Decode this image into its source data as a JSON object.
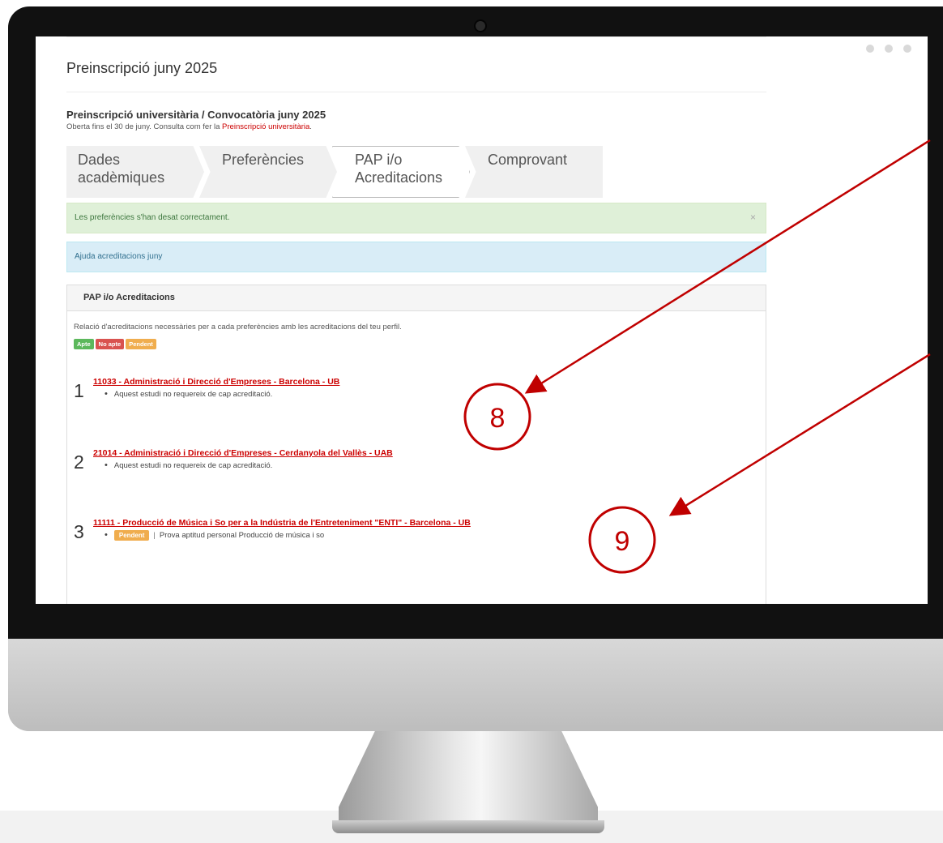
{
  "page": {
    "title": "Preinscripció juny 2025",
    "subtitle": "Preinscripció universitària / Convocatòria juny 2025",
    "subtext_prefix": "Oberta fins el 30 de juny. Consulta com fer la ",
    "subtext_link": "Preinscripció universitària",
    "subtext_suffix": "."
  },
  "steps": [
    {
      "label": "Dades acadèmiques"
    },
    {
      "label": "Preferències"
    },
    {
      "label": "PAP i/o Acreditacions"
    },
    {
      "label": "Comprovant"
    }
  ],
  "alerts": {
    "success": "Les preferències s'han desat correctament.",
    "close": "×",
    "info": "Ajuda acreditacions juny"
  },
  "panel": {
    "heading": "PAP i/o Acreditacions",
    "intro": "Relació d'acreditacions necessàries per a cada preferències amb les acreditacions del teu perfil.",
    "badges": {
      "apte": "Apte",
      "no_apte": "No apte",
      "pendent": "Pendent"
    }
  },
  "preferences": [
    {
      "num": "1",
      "title": "11033 - Administració i Direcció d'Empreses - Barcelona - UB",
      "note": "Aquest estudi no requereix de cap acreditació."
    },
    {
      "num": "2",
      "title": "21014 - Administració i Direcció d'Empreses - Cerdanyola del Vallès - UAB",
      "note": "Aquest estudi no requereix de cap acreditació."
    },
    {
      "num": "3",
      "title": "11111 - Producció de Música i So per a la Indústria de l'Entreteniment \"ENTI\" - Barcelona - UB",
      "badge": "Pendent",
      "separator": "|",
      "note": "Prova aptitud personal Producció de música i so"
    }
  ],
  "annotations": {
    "marker_a": "8",
    "marker_b": "9",
    "color": "#c00000"
  },
  "icons": {
    "bullet": "•"
  }
}
